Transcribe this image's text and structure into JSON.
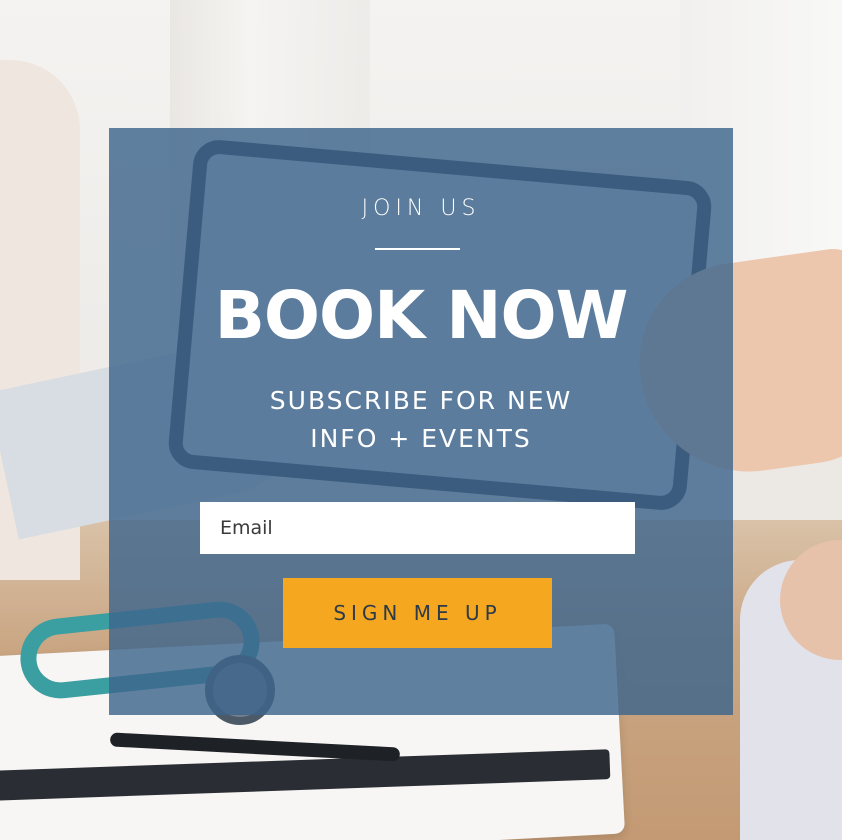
{
  "form": {
    "eyebrow": "JOIN US",
    "headline": "BOOK NOW",
    "subtitle_line1": "SUBSCRIBE FOR NEW",
    "subtitle_line2": "INFO + EVENTS",
    "email_placeholder": "Email",
    "submit_label": "SIGN ME UP"
  },
  "colors": {
    "overlay": "#3e658c",
    "button": "#f5a720",
    "button_text": "#2d3a48",
    "text": "#ffffff"
  },
  "background": {
    "description_icon": "doctor-consultation-photo"
  }
}
